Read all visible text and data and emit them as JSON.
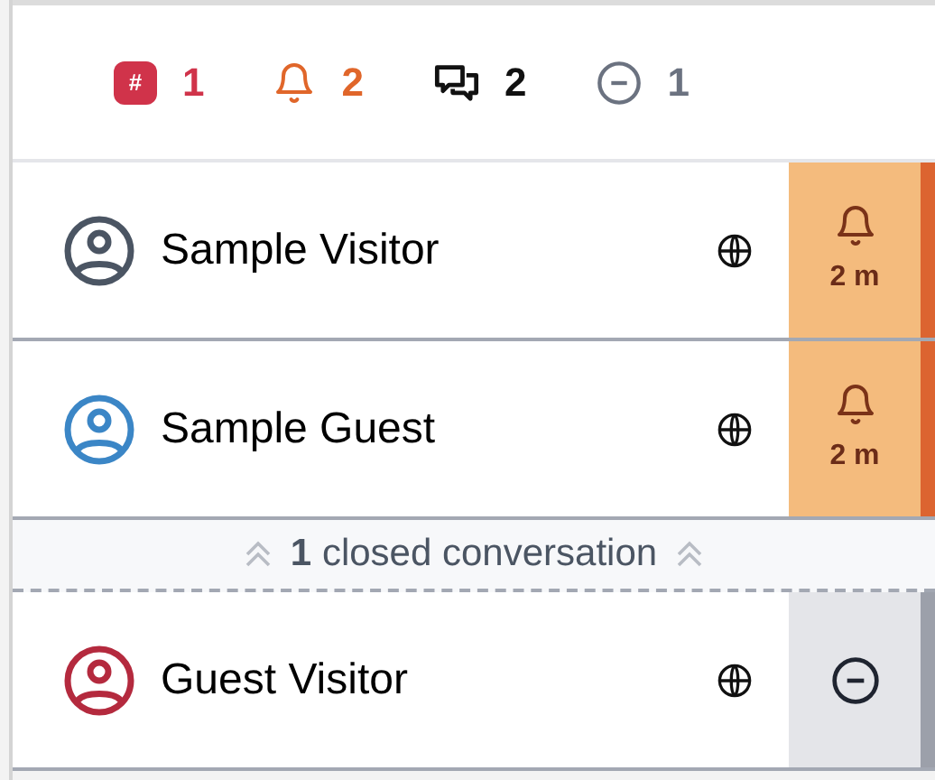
{
  "counters": [
    {
      "kind": "tag",
      "symbol": "#",
      "value": "1",
      "color": "#d0334a"
    },
    {
      "kind": "bell",
      "value": "2",
      "color": "#e0662a"
    },
    {
      "kind": "chat",
      "value": "2",
      "color": "#111111"
    },
    {
      "kind": "minus",
      "value": "1",
      "color": "#6b7280"
    }
  ],
  "conversations_open": [
    {
      "name": "Sample Visitor",
      "color": "#4b5563",
      "kind": "waiting",
      "time": "2 m"
    },
    {
      "name": "Sample Guest",
      "color": "#3b86c6",
      "kind": "waiting",
      "time": "2 m"
    }
  ],
  "closed_toggle": {
    "label": "**1** closed conversation",
    "expanded": true
  },
  "conversations_closed": [
    {
      "name": "Guest Visitor",
      "color": "#b42a3e",
      "kind": "closed"
    }
  ]
}
